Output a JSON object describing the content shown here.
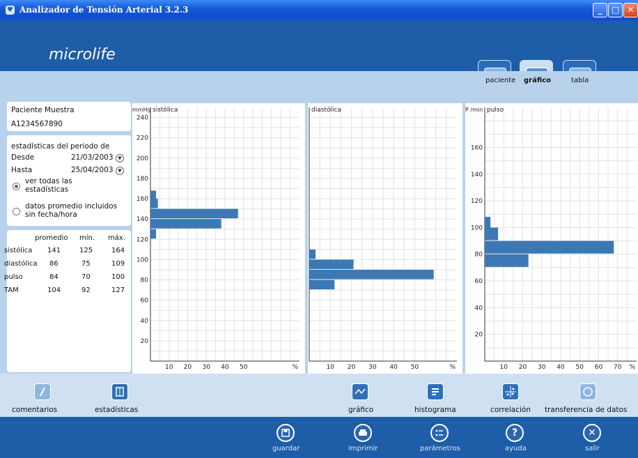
{
  "window": {
    "title": "Analizador de Tensión Arterial 3.2.3"
  },
  "header": {
    "logo": "microlife"
  },
  "tabs": [
    {
      "label": "paciente",
      "icon": "patient-icon"
    },
    {
      "label": "gráfico",
      "icon": "graph-icon",
      "active": true
    },
    {
      "label": "tabla",
      "icon": "table-icon"
    }
  ],
  "patient": {
    "name": "Paciente Muestra",
    "id": "A1234567890"
  },
  "period": {
    "heading": "estadísticas del periodo de",
    "from_label": "Desde",
    "from_value": "21/03/2003",
    "to_label": "Hasta",
    "to_value": "25/04/2003",
    "option_all": "ver todas las estadísticas",
    "option_avg": "datos promedio incluidos sin fecha/hora"
  },
  "stats": {
    "headers": [
      "promedio",
      "mín.",
      "máx."
    ],
    "rows": [
      {
        "label": "sistólica",
        "avg": "141",
        "min": "125",
        "max": "164"
      },
      {
        "label": "diastólica",
        "avg": "86",
        "min": "75",
        "max": "109"
      },
      {
        "label": "pulso",
        "avg": "84",
        "min": "70",
        "max": "100"
      },
      {
        "label": "TAM",
        "avg": "104",
        "min": "92",
        "max": "127"
      }
    ]
  },
  "chart_data": [
    {
      "type": "bar",
      "orientation": "horizontal",
      "title": "sistólica",
      "ylabel": "mmHg",
      "xlabel": "%",
      "ylim": [
        0,
        250
      ],
      "xlim": [
        0,
        80
      ],
      "yticks": [
        20,
        40,
        60,
        80,
        100,
        120,
        140,
        160,
        180,
        200,
        220,
        240
      ],
      "xticks": [
        10,
        20,
        30,
        40,
        50
      ],
      "bars": [
        {
          "y": 125,
          "value": 3
        },
        {
          "y": 135,
          "value": 38
        },
        {
          "y": 145,
          "value": 47
        },
        {
          "y": 155,
          "value": 4
        },
        {
          "y": 163,
          "value": 3
        }
      ]
    },
    {
      "type": "bar",
      "orientation": "horizontal",
      "title": "diastólica",
      "ylabel": "",
      "xlabel": "%",
      "ylim": [
        0,
        250
      ],
      "xlim": [
        0,
        70
      ],
      "yticks": [],
      "xticks": [
        10,
        20,
        30,
        40,
        50
      ],
      "bars": [
        {
          "y": 75,
          "value": 12
        },
        {
          "y": 85,
          "value": 59
        },
        {
          "y": 95,
          "value": 21
        },
        {
          "y": 105,
          "value": 3
        }
      ]
    },
    {
      "type": "bar",
      "orientation": "horizontal",
      "title": "pulso",
      "ylabel": "P /min",
      "xlabel": "%",
      "ylim": [
        0,
        190
      ],
      "xlim": [
        0,
        80
      ],
      "yticks": [
        20,
        40,
        60,
        80,
        100,
        120,
        140,
        160
      ],
      "xticks": [
        10,
        20,
        30,
        40,
        50,
        60,
        70
      ],
      "bars": [
        {
          "y": 75,
          "value": 23
        },
        {
          "y": 85,
          "value": 68
        },
        {
          "y": 95,
          "value": 7
        },
        {
          "y": 103,
          "value": 3
        }
      ]
    }
  ],
  "bottom_toolbar": [
    {
      "label": "comentarios",
      "icon": "pencil-icon"
    },
    {
      "label": "estadísticas",
      "icon": "statistics-icon"
    },
    {
      "label": "gráfico",
      "icon": "line-chart-icon"
    },
    {
      "label": "histograma",
      "icon": "histogram-icon"
    },
    {
      "label": "correlación",
      "icon": "scatter-icon"
    },
    {
      "label": "transferencia de datos",
      "icon": "transfer-icon"
    }
  ],
  "footer": [
    {
      "label": "guardar",
      "icon": "save-icon"
    },
    {
      "label": "imprimir",
      "icon": "print-icon"
    },
    {
      "label": "parámetros",
      "icon": "settings-icon"
    },
    {
      "label": "ayuda",
      "icon": "help-icon"
    },
    {
      "label": "salir",
      "icon": "exit-icon"
    }
  ],
  "colors": {
    "bar": "#3c78b4",
    "header": "#1e5da7",
    "panel": "#b9d2ec"
  }
}
